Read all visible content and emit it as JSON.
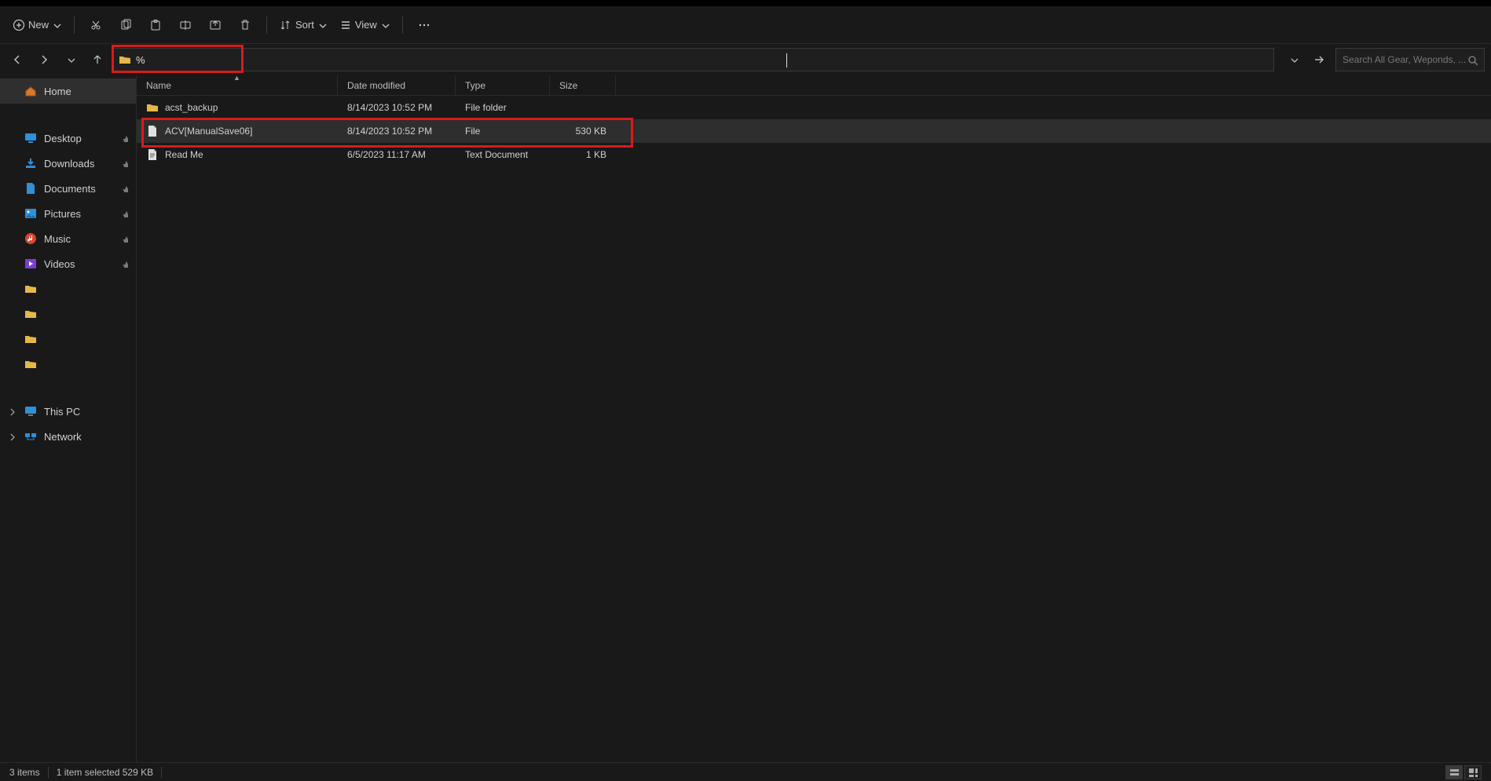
{
  "toolbar": {
    "new_label": "New",
    "sort_label": "Sort",
    "view_label": "View"
  },
  "address": {
    "text": "%"
  },
  "search": {
    "placeholder": "Search All Gear, Weponds, ..."
  },
  "sidebar": {
    "home_label": "Home",
    "quick": [
      {
        "label": "Desktop",
        "icon": "desktop",
        "pinned": true
      },
      {
        "label": "Downloads",
        "icon": "downloads",
        "pinned": true
      },
      {
        "label": "Documents",
        "icon": "documents",
        "pinned": true
      },
      {
        "label": "Pictures",
        "icon": "pictures",
        "pinned": true
      },
      {
        "label": "Music",
        "icon": "music",
        "pinned": true
      },
      {
        "label": "Videos",
        "icon": "videos",
        "pinned": true
      },
      {
        "label": "",
        "icon": "folder",
        "pinned": false
      },
      {
        "label": "",
        "icon": "folder",
        "pinned": false
      },
      {
        "label": "",
        "icon": "folder",
        "pinned": false
      },
      {
        "label": "",
        "icon": "folder",
        "pinned": false
      }
    ],
    "thispc_label": "This PC",
    "network_label": "Network"
  },
  "columns": {
    "name": "Name",
    "modified": "Date modified",
    "type": "Type",
    "size": "Size"
  },
  "rows": [
    {
      "icon": "folder",
      "name": "acst_backup",
      "modified": "8/14/2023 10:52 PM",
      "type": "File folder",
      "size": "",
      "selected": false,
      "highlight": false
    },
    {
      "icon": "file",
      "name": "ACV[ManualSave06]",
      "modified": "8/14/2023 10:52 PM",
      "type": "File",
      "size": "530 KB",
      "selected": true,
      "highlight": true
    },
    {
      "icon": "text",
      "name": "Read Me",
      "modified": "6/5/2023 11:17 AM",
      "type": "Text Document",
      "size": "1 KB",
      "selected": false,
      "highlight": false
    }
  ],
  "status": {
    "count": "3 items",
    "selection": "1 item selected  529 KB"
  }
}
